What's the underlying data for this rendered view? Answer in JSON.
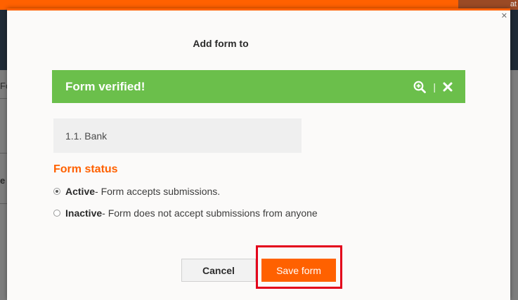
{
  "background": {
    "corner_text": "at",
    "side_texts": [
      "Fo",
      "e"
    ]
  },
  "modal": {
    "title": "Add form to",
    "close_glyph": "✕"
  },
  "verified_bar": {
    "text": "Form verified!",
    "separator": "|"
  },
  "form_field": {
    "value": "1.1. Bank"
  },
  "form_status": {
    "title": "Form status",
    "options": [
      {
        "label": "Active",
        "description": " - Form accepts submissions.",
        "checked": true
      },
      {
        "label": "Inactive",
        "description": " - Form does not accept submissions from anyone",
        "checked": false
      }
    ]
  },
  "buttons": {
    "cancel_label": "Cancel",
    "save_label": "Save form"
  },
  "colors": {
    "accent": "#ff6100",
    "success": "#6bbf4b",
    "highlight": "#e3001b"
  },
  "icons": {
    "zoom": "zoom-in-icon",
    "close": "close-icon"
  }
}
